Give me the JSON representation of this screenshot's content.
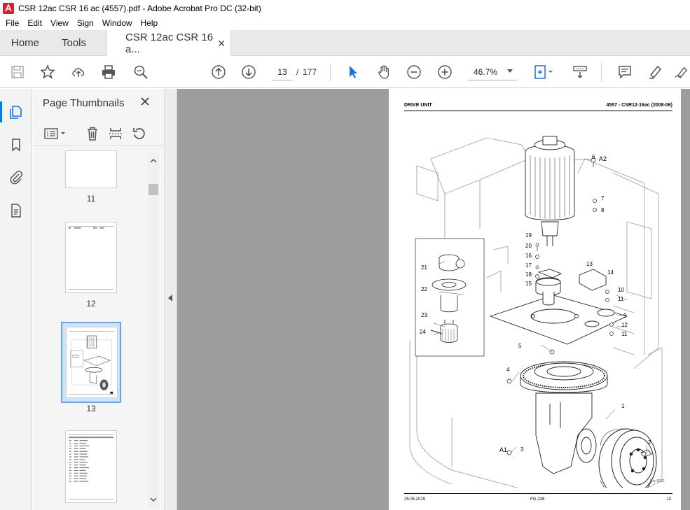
{
  "window": {
    "title": "CSR 12ac CSR 16 ac (4557).pdf - Adobe Acrobat Pro DC (32-bit)"
  },
  "menu": [
    "File",
    "Edit",
    "View",
    "Sign",
    "Window",
    "Help"
  ],
  "tabs": {
    "home": "Home",
    "tools": "Tools",
    "document": "CSR 12ac CSR 16 a..."
  },
  "toolbar": {
    "current_page": "13",
    "page_separator": "/",
    "total_pages": "177",
    "zoom": "46.7%"
  },
  "panel": {
    "title": "Page Thumbnails",
    "thumbnails": [
      {
        "label": "11"
      },
      {
        "label": "12"
      },
      {
        "label": "13",
        "selected": true
      },
      {
        "label": ""
      }
    ]
  },
  "document_page": {
    "header_left": "DRIVE UNIT",
    "header_right": "4557 - CSR12-16ac (2008-06)",
    "footer_left": "25.05.2019",
    "footer_center": "FG-226",
    "footer_right": "13",
    "drawing_code": "Drs-5922",
    "callouts": [
      "A2",
      "6",
      "7",
      "8",
      "19",
      "20",
      "16",
      "17",
      "18",
      "15",
      "13",
      "14",
      "10",
      "11",
      "9",
      "12",
      "11",
      "21",
      "22",
      "23",
      "24",
      "5",
      "4",
      "3",
      "A1",
      "1",
      "2"
    ]
  },
  "colors": {
    "accent": "#1473e6",
    "viewer_bg": "#9d9d9d",
    "tab_bg": "#e9e9e9"
  }
}
